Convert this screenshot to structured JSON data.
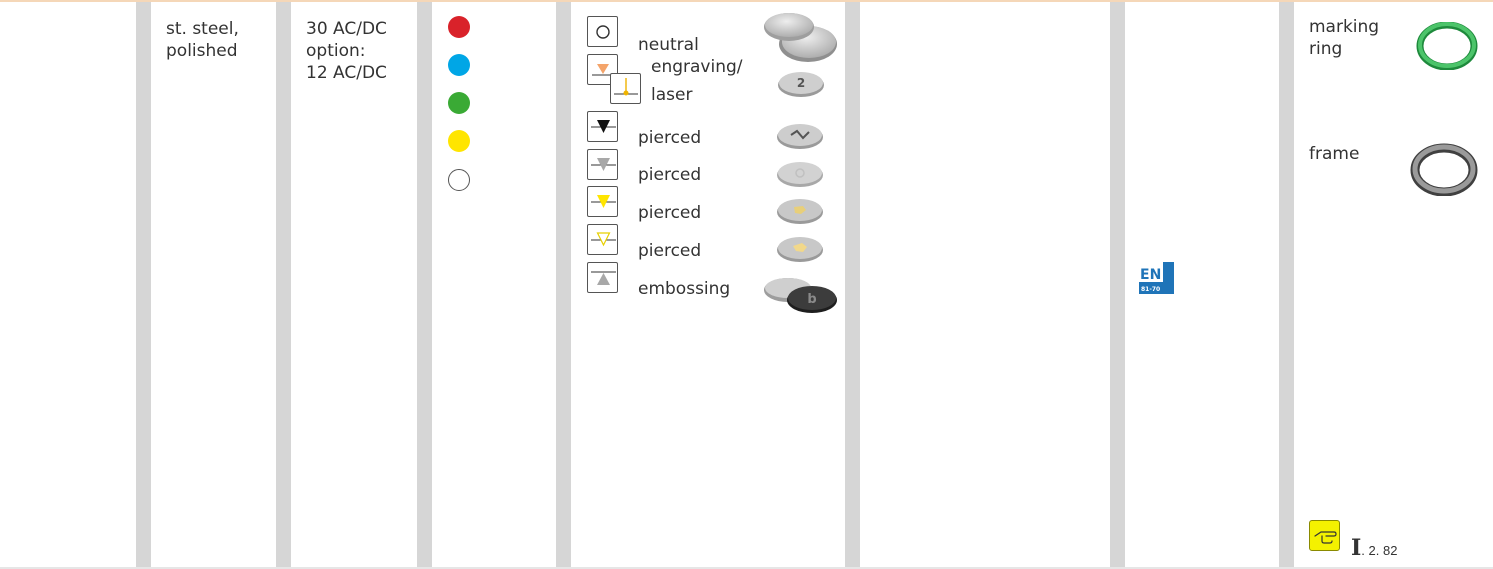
{
  "material": {
    "line1": "st. steel,",
    "line2": "polished"
  },
  "voltage": {
    "line1": "30 AC/DC",
    "line2": "option:",
    "line3": "12 AC/DC"
  },
  "led_colors": [
    {
      "name": "red",
      "color": "#d9222a"
    },
    {
      "name": "blue",
      "color": "#00a6e6"
    },
    {
      "name": "green",
      "color": "#3aaa35"
    },
    {
      "name": "yellow",
      "color": "#ffe500"
    },
    {
      "name": "white",
      "color": "#ffffff"
    }
  ],
  "symbols": {
    "neutral": "neutral",
    "engraving_line1": "engraving/",
    "engraving_line2": "laser",
    "pierced_black": "pierced",
    "pierced_grey": "pierced",
    "pierced_yellow": "pierced",
    "pierced_yellow_outline": "pierced",
    "embossing": "embossing"
  },
  "standard_badge": {
    "code": "EN",
    "number": "81-70",
    "color": "#1f74b8"
  },
  "accessories": {
    "marking_ring_line1": "marking",
    "marking_ring_line2": "ring",
    "marking_ring_color": "#2fa84f",
    "frame": "frame"
  },
  "reference": {
    "roman": "I",
    "section": ". 2. 82",
    "icon": "pointing-hand-icon",
    "icon_color": "#f4f100"
  }
}
